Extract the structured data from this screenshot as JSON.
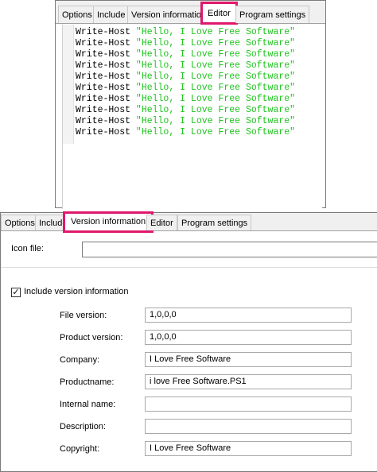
{
  "top_window": {
    "tabs": [
      {
        "label": "Options"
      },
      {
        "label": "Include"
      },
      {
        "label": "Version information"
      },
      {
        "label": "Editor"
      },
      {
        "label": "Program settings"
      }
    ],
    "active_tab": "Editor",
    "highlight_color": "#e0186c",
    "code_lines": [
      {
        "cmd": "Write-Host",
        "arg": "\"Hello, I Love Free Software\""
      },
      {
        "cmd": "Write-Host",
        "arg": "\"Hello, I Love Free Software\""
      },
      {
        "cmd": "Write-Host",
        "arg": "\"Hello, I Love Free Software\""
      },
      {
        "cmd": "Write-Host",
        "arg": "\"Hello, I Love Free Software\""
      },
      {
        "cmd": "Write-Host",
        "arg": "\"Hello, I Love Free Software\""
      },
      {
        "cmd": "Write-Host",
        "arg": "\"Hello, I Love Free Software\""
      },
      {
        "cmd": "Write-Host",
        "arg": "\"Hello, I Love Free Software\""
      },
      {
        "cmd": "Write-Host",
        "arg": "\"Hello, I Love Free Software\""
      },
      {
        "cmd": "Write-Host",
        "arg": "\"Hello, I Love Free Software\""
      },
      {
        "cmd": "Write-Host",
        "arg": "\"Hello, I Love Free Software\""
      }
    ]
  },
  "bottom_window": {
    "tabs": [
      {
        "label": "Options"
      },
      {
        "label": "Include"
      },
      {
        "label": "Version information"
      },
      {
        "label": "Editor"
      },
      {
        "label": "Program settings"
      }
    ],
    "active_tab": "Version information",
    "icon_file": {
      "label": "Icon file:",
      "value": ""
    },
    "include_version": {
      "label": "Include version information",
      "checked": true,
      "mark": "✓"
    },
    "fields": [
      {
        "label": "File version:",
        "value": "1,0,0,0"
      },
      {
        "label": "Product version:",
        "value": "1,0,0,0"
      },
      {
        "label": "Company:",
        "value": "I Love Free Software"
      },
      {
        "label": "Productname:",
        "value": "i love Free Software.PS1"
      },
      {
        "label": "Internal name:",
        "value": ""
      },
      {
        "label": "Description:",
        "value": ""
      },
      {
        "label": "Copyright:",
        "value": "I Love Free Software"
      }
    ]
  }
}
